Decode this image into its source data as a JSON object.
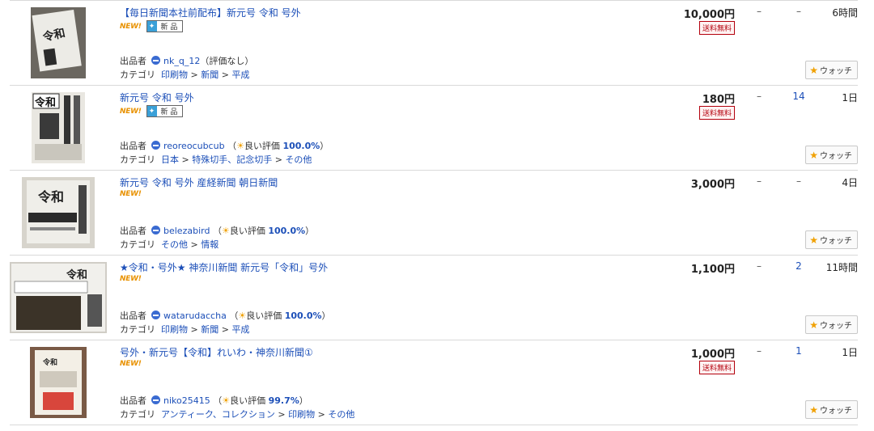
{
  "listings": [
    {
      "title": "【毎日新聞本社前配布】新元号 令和 号外",
      "new_badge": "NEW!",
      "new_item_label": "新 品",
      "show_new_item": true,
      "price": "10,000円",
      "free_shipping": "送料無料",
      "show_free": true,
      "bids": "–",
      "watchers": "–",
      "time_left": "6時間",
      "seller_label": "出品者",
      "seller_name": "nk_q_12",
      "rating_text": "（評価なし）",
      "rating_good": "",
      "rating_pct": "",
      "rating_close": "",
      "category_label": "カテゴリ",
      "categories": [
        "印刷物",
        "新聞",
        "平成"
      ],
      "watch_label": "ウォッチ"
    },
    {
      "title": "新元号 令和 号外",
      "new_badge": "NEW!",
      "new_item_label": "新 品",
      "show_new_item": true,
      "price": "180円",
      "free_shipping": "送料無料",
      "show_free": true,
      "bids": "–",
      "watchers": "14",
      "time_left": "1日",
      "seller_label": "出品者",
      "seller_name": "reoreocubcub",
      "rating_text": "（",
      "rating_good": "良い評価",
      "rating_pct": "100.0%",
      "rating_close": "）",
      "category_label": "カテゴリ",
      "categories": [
        "日本",
        "特殊切手、記念切手",
        "その他"
      ],
      "watch_label": "ウォッチ"
    },
    {
      "title": "新元号 令和 号外 産経新聞 朝日新聞",
      "new_badge": "NEW!",
      "new_item_label": "",
      "show_new_item": false,
      "price": "3,000円",
      "free_shipping": "",
      "show_free": false,
      "bids": "–",
      "watchers": "–",
      "time_left": "4日",
      "seller_label": "出品者",
      "seller_name": "belezabird",
      "rating_text": "（",
      "rating_good": "良い評価",
      "rating_pct": "100.0%",
      "rating_close": "）",
      "category_label": "カテゴリ",
      "categories": [
        "その他",
        "情報"
      ],
      "watch_label": "ウォッチ"
    },
    {
      "title": "★令和・号外★ 神奈川新聞 新元号「令和」号外",
      "new_badge": "NEW!",
      "new_item_label": "",
      "show_new_item": false,
      "price": "1,100円",
      "free_shipping": "",
      "show_free": false,
      "bids": "–",
      "watchers": "2",
      "time_left": "11時間",
      "seller_label": "出品者",
      "seller_name": "watarudaccha",
      "rating_text": "（",
      "rating_good": "良い評価",
      "rating_pct": "100.0%",
      "rating_close": "）",
      "category_label": "カテゴリ",
      "categories": [
        "印刷物",
        "新聞",
        "平成"
      ],
      "watch_label": "ウォッチ"
    },
    {
      "title": "号外・新元号【令和】れいわ・神奈川新聞①",
      "new_badge": "NEW!",
      "new_item_label": "",
      "show_new_item": false,
      "price": "1,000円",
      "free_shipping": "送料無料",
      "show_free": true,
      "bids": "–",
      "watchers": "1",
      "time_left": "1日",
      "seller_label": "出品者",
      "seller_name": "niko25415",
      "rating_text": "（",
      "rating_good": "良い評価",
      "rating_pct": "99.7%",
      "rating_close": "）",
      "category_label": "カテゴリ",
      "categories": [
        "アンティーク、コレクション",
        "印刷物",
        "その他"
      ],
      "watch_label": "ウォッチ"
    }
  ],
  "thumb_captions": [
    "令和",
    "令和",
    "令和",
    "令和",
    "令和"
  ],
  "colors": {
    "link": "#1c4fb8",
    "new": "#e89100",
    "free": "#b3000d",
    "star": "#f0a000"
  }
}
